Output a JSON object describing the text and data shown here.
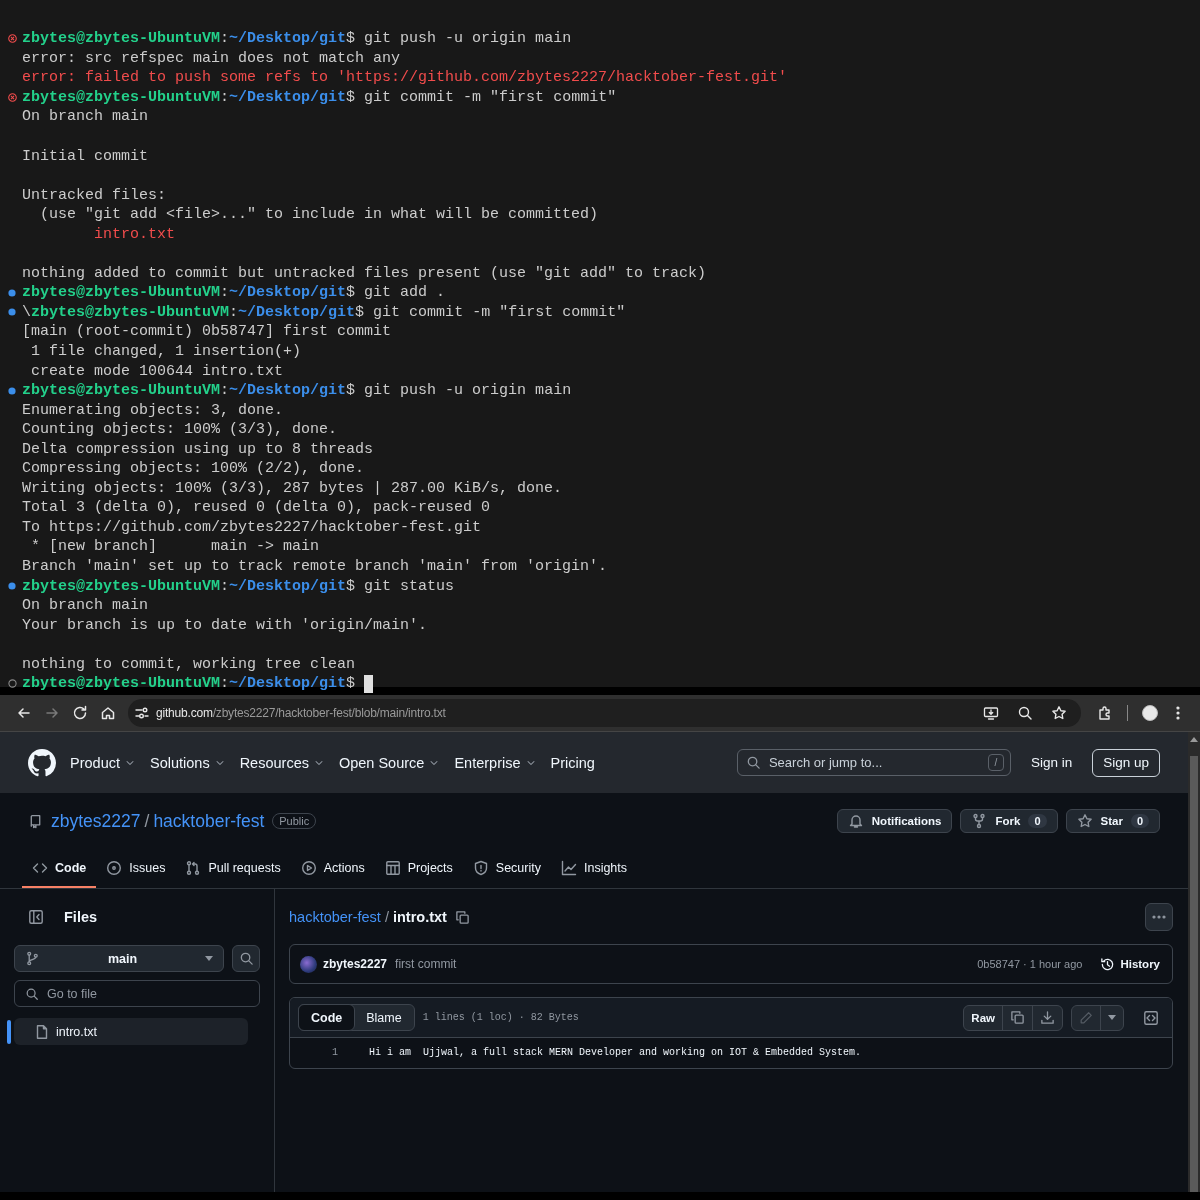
{
  "terminal": {
    "lines": [
      {
        "kind": "prompt",
        "marker": {
          "kind": "error"
        },
        "parts": [
          {
            "kind": "user",
            "text": "zbytes@zbytes-UbuntuVM"
          },
          {
            "kind": "plain",
            "text": ":"
          },
          {
            "kind": "path",
            "text": "~/Desktop/git"
          },
          {
            "kind": "plain",
            "text": "$ git push -u origin main"
          }
        ]
      },
      {
        "kind": "output",
        "text": "error: src refspec main does not match any"
      },
      {
        "kind": "error",
        "text": "error: failed to push some refs to 'https://github.com/zbytes2227/hacktober-fest.git'"
      },
      {
        "kind": "prompt",
        "marker": {
          "kind": "error"
        },
        "parts": [
          {
            "kind": "user",
            "text": "zbytes@zbytes-UbuntuVM"
          },
          {
            "kind": "plain",
            "text": ":"
          },
          {
            "kind": "path",
            "text": "~/Desktop/git"
          },
          {
            "kind": "plain",
            "text": "$ git commit -m \"first commit\""
          }
        ]
      },
      {
        "kind": "output",
        "text": "On branch main"
      },
      {
        "kind": "blank"
      },
      {
        "kind": "output",
        "text": "Initial commit"
      },
      {
        "kind": "blank"
      },
      {
        "kind": "output",
        "text": "Untracked files:"
      },
      {
        "kind": "output",
        "text": "  (use \"git add <file>...\" to include in what will be committed)"
      },
      {
        "kind": "error",
        "text": "        intro.txt"
      },
      {
        "kind": "blank"
      },
      {
        "kind": "output",
        "text": "nothing added to commit but untracked files present (use \"git add\" to track)"
      },
      {
        "kind": "prompt",
        "marker": {
          "kind": "success"
        },
        "parts": [
          {
            "kind": "user",
            "text": "zbytes@zbytes-UbuntuVM"
          },
          {
            "kind": "plain",
            "text": ":"
          },
          {
            "kind": "path",
            "text": "~/Desktop/git"
          },
          {
            "kind": "plain",
            "text": "$ git add ."
          }
        ]
      },
      {
        "kind": "prompt",
        "marker": {
          "kind": "success"
        },
        "parts": [
          {
            "kind": "plain",
            "text": "\\"
          },
          {
            "kind": "user",
            "text": "zbytes@zbytes-UbuntuVM"
          },
          {
            "kind": "plain",
            "text": ":"
          },
          {
            "kind": "path",
            "text": "~/Desktop/git"
          },
          {
            "kind": "plain",
            "text": "$ git commit -m \"first commit\""
          }
        ]
      },
      {
        "kind": "output",
        "text": "[main (root-commit) 0b58747] first commit"
      },
      {
        "kind": "output",
        "text": " 1 file changed, 1 insertion(+)"
      },
      {
        "kind": "output",
        "text": " create mode 100644 intro.txt"
      },
      {
        "kind": "prompt",
        "marker": {
          "kind": "success"
        },
        "parts": [
          {
            "kind": "user",
            "text": "zbytes@zbytes-UbuntuVM"
          },
          {
            "kind": "plain",
            "text": ":"
          },
          {
            "kind": "path",
            "text": "~/Desktop/git"
          },
          {
            "kind": "plain",
            "text": "$ git push -u origin main"
          }
        ]
      },
      {
        "kind": "output",
        "text": "Enumerating objects: 3, done."
      },
      {
        "kind": "output",
        "text": "Counting objects: 100% (3/3), done."
      },
      {
        "kind": "output",
        "text": "Delta compression using up to 8 threads"
      },
      {
        "kind": "output",
        "text": "Compressing objects: 100% (2/2), done."
      },
      {
        "kind": "output",
        "text": "Writing objects: 100% (3/3), 287 bytes | 287.00 KiB/s, done."
      },
      {
        "kind": "output",
        "text": "Total 3 (delta 0), reused 0 (delta 0), pack-reused 0"
      },
      {
        "kind": "output",
        "text": "To https://github.com/zbytes2227/hacktober-fest.git"
      },
      {
        "kind": "output",
        "text": " * [new branch]      main -> main"
      },
      {
        "kind": "output",
        "text": "Branch 'main' set up to track remote branch 'main' from 'origin'."
      },
      {
        "kind": "prompt",
        "marker": {
          "kind": "success"
        },
        "parts": [
          {
            "kind": "user",
            "text": "zbytes@zbytes-UbuntuVM"
          },
          {
            "kind": "plain",
            "text": ":"
          },
          {
            "kind": "path",
            "text": "~/Desktop/git"
          },
          {
            "kind": "plain",
            "text": "$ git status"
          }
        ]
      },
      {
        "kind": "output",
        "text": "On branch main"
      },
      {
        "kind": "output",
        "text": "Your branch is up to date with 'origin/main'."
      },
      {
        "kind": "blank"
      },
      {
        "kind": "output",
        "text": "nothing to commit, working tree clean"
      },
      {
        "kind": "prompt",
        "marker": {
          "kind": "idle"
        },
        "cursor": true,
        "parts": [
          {
            "kind": "user",
            "text": "zbytes@zbytes-UbuntuVM"
          },
          {
            "kind": "plain",
            "text": ":"
          },
          {
            "kind": "path",
            "text": "~/Desktop/git"
          },
          {
            "kind": "plain",
            "text": "$ "
          }
        ]
      }
    ]
  },
  "browser": {
    "forward_disabled": true,
    "url_host": "github.com",
    "url_path": "/zbytes2227/hacktober-fest/blob/main/intro.txt"
  },
  "header": {
    "nav": [
      {
        "label": "Product",
        "has_menu": true
      },
      {
        "label": "Solutions",
        "has_menu": true
      },
      {
        "label": "Resources",
        "has_menu": true
      },
      {
        "label": "Open Source",
        "has_menu": true
      },
      {
        "label": "Enterprise",
        "has_menu": true
      },
      {
        "label": "Pricing",
        "has_menu": false
      }
    ],
    "search": {
      "placeholder": "Search or jump to...",
      "shortcut": "/"
    },
    "sign_in": "Sign in",
    "sign_up": "Sign up"
  },
  "repo": {
    "owner": "zbytes2227",
    "separator": "/",
    "name": "hacktober-fest",
    "visibility": "Public",
    "actions": [
      {
        "kind": "notifications",
        "label": "Notifications"
      },
      {
        "kind": "fork",
        "label": "Fork",
        "count": "0"
      },
      {
        "kind": "star",
        "label": "Star",
        "count": "0"
      }
    ],
    "tabs": [
      {
        "kind": "code",
        "label": "Code",
        "selected": true
      },
      {
        "kind": "issues",
        "label": "Issues",
        "selected": false
      },
      {
        "kind": "pulls",
        "label": "Pull requests",
        "selected": false
      },
      {
        "kind": "actions",
        "label": "Actions",
        "selected": false
      },
      {
        "kind": "projects",
        "label": "Projects",
        "selected": false
      },
      {
        "kind": "security",
        "label": "Security",
        "selected": false
      },
      {
        "kind": "insights",
        "label": "Insights",
        "selected": false
      }
    ]
  },
  "sidebar": {
    "title": "Files",
    "branch": "main",
    "file_search": {
      "placeholder": "Go to file"
    },
    "tree": [
      {
        "name": "intro.txt",
        "selected": true
      }
    ]
  },
  "file": {
    "breadcrumb_repo": "hacktober-fest",
    "breadcrumb_sep": "/",
    "breadcrumb_file": "intro.txt",
    "commit": {
      "author": "zbytes2227",
      "message": "first commit",
      "meta": "0b58747 · 1 hour ago",
      "history": "History"
    },
    "view_modes": [
      {
        "label": "Code",
        "selected": true
      },
      {
        "label": "Blame",
        "selected": false
      }
    ],
    "stats": "1 lines (1 loc) · 82 Bytes",
    "raw": "Raw",
    "edit_disabled": true,
    "lines": [
      {
        "number": "1",
        "text": "Hi i am  Ujjwal, a full stack MERN Developer and working on IOT & Embedded System."
      }
    ]
  }
}
